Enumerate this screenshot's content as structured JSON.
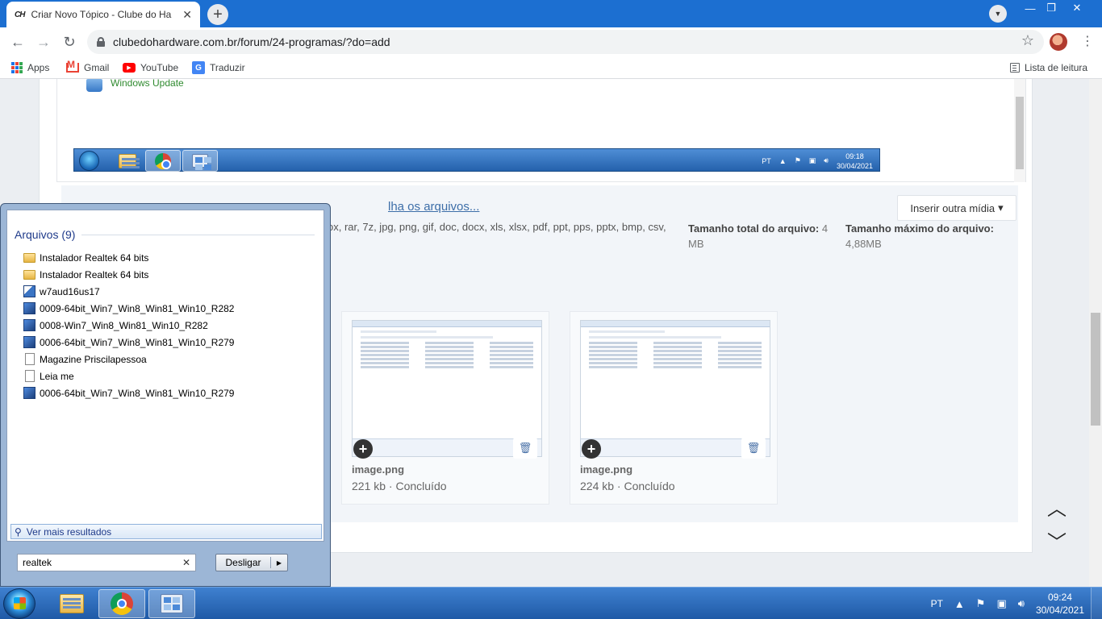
{
  "browser": {
    "tab_title": "Criar Novo Tópico - Clube do Ha",
    "tab_favicon": "CH",
    "url": "clubedohardware.com.br/forum/24-programas/?do=add",
    "bookmarks": [
      {
        "label": "Apps",
        "icon": "apps-icon"
      },
      {
        "label": "Gmail",
        "icon": "gmail-icon"
      },
      {
        "label": "YouTube",
        "icon": "youtube-icon"
      },
      {
        "label": "Traduzir",
        "icon": "translate-icon"
      }
    ],
    "reading_list": "Lista de leitura"
  },
  "editor": {
    "windows_update_text": "Windows Update",
    "mini_taskbar": {
      "lang": "PT",
      "time": "09:18",
      "date": "30/04/2021"
    }
  },
  "attachments": {
    "choose_link": "lha os arquivos...",
    "allowed_types": "ox, rar, 7z, jpg, png, gif, doc, docx, xls, xlsx, pdf, ppt, pps, pptx, bmp, csv,",
    "total_size_label": "Tamanho total do arquivo:",
    "total_size_value": "4 MB",
    "max_size_label": "Tamanho máximo do arquivo:",
    "max_size_value": "4,88MB",
    "insert_button": "Inserir outra mídia",
    "files": [
      {
        "name": "image.png",
        "meta": "221 kb · Concluído"
      },
      {
        "name": "image.png",
        "meta": "224 kb · Concluído"
      }
    ]
  },
  "start_menu": {
    "files_header": "Arquivos (9)",
    "files": [
      {
        "label": "Instalador Realtek 64 bits",
        "icon": "folder-icon"
      },
      {
        "label": "Instalador Realtek 64 bits",
        "icon": "folder-icon"
      },
      {
        "label": "w7aud16us17",
        "icon": "setup-icon"
      },
      {
        "label": "0009-64bit_Win7_Win8_Win81_Win10_R282",
        "icon": "exe-icon"
      },
      {
        "label": "0008-Win7_Win8_Win81_Win10_R282",
        "icon": "exe-icon"
      },
      {
        "label": "0006-64bit_Win7_Win8_Win81_Win10_R279",
        "icon": "exe-icon"
      },
      {
        "label": "Magazine Priscilapessoa",
        "icon": "document-icon"
      },
      {
        "label": "Leia me",
        "icon": "document-icon"
      },
      {
        "label": "0006-64bit_Win7_Win8_Win81_Win10_R279",
        "icon": "exe-icon"
      }
    ],
    "more_results": "Ver mais resultados",
    "search_value": "realtek",
    "shutdown_label": "Desligar"
  },
  "taskbar": {
    "lang": "PT",
    "time": "09:24",
    "date": "30/04/2021"
  }
}
